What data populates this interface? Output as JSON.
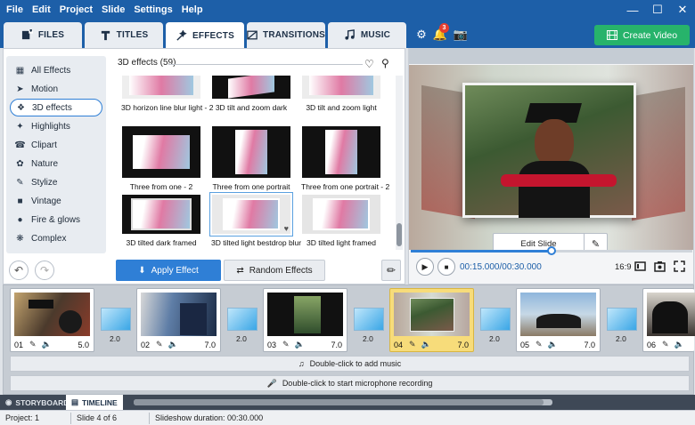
{
  "menu": [
    "File",
    "Edit",
    "Project",
    "Slide",
    "Settings",
    "Help"
  ],
  "tabs": [
    {
      "label": "FILES",
      "icon": "files-icon"
    },
    {
      "label": "TITLES",
      "icon": "titles-icon"
    },
    {
      "label": "EFFECTS",
      "icon": "effects-icon"
    },
    {
      "label": "TRANSITIONS",
      "icon": "transitions-icon"
    },
    {
      "label": "MUSIC",
      "icon": "music-icon"
    }
  ],
  "notification_count": "3",
  "create_video_label": "Create Video",
  "categories": [
    {
      "label": "All Effects",
      "icon": "grid-icon"
    },
    {
      "label": "Motion",
      "icon": "motion-icon"
    },
    {
      "label": "3D effects",
      "icon": "cube-icon"
    },
    {
      "label": "Highlights",
      "icon": "sparkle-icon"
    },
    {
      "label": "Clipart",
      "icon": "clipart-icon"
    },
    {
      "label": "Nature",
      "icon": "leaf-icon"
    },
    {
      "label": "Stylize",
      "icon": "stylize-icon"
    },
    {
      "label": "Vintage",
      "icon": "vintage-icon"
    },
    {
      "label": "Fire & glows",
      "icon": "fire-icon"
    },
    {
      "label": "Complex",
      "icon": "complex-icon"
    }
  ],
  "effects_header": "3D effects (59)",
  "effects": [
    "3D horizon line blur light - 2",
    "3D tilt and zoom dark",
    "3D tilt and zoom light",
    "Three from one - 2",
    "Three from one portrait",
    "Three from one portrait - 2",
    "3D tilted dark framed",
    "3D tilted light bestdrop blur",
    "3D tilted light framed"
  ],
  "apply_effect_label": "Apply Effect",
  "random_effects_label": "Random Effects",
  "edit_slide_label": "Edit Slide",
  "timecode": "00:15.000/00:30.000",
  "playback_progress": 0.5,
  "aspect_ratio": "16:9",
  "slides": [
    {
      "num": "01",
      "dur": "5.0"
    },
    {
      "num": "02",
      "dur": "7.0"
    },
    {
      "num": "03",
      "dur": "7.0"
    },
    {
      "num": "04",
      "dur": "7.0"
    },
    {
      "num": "05",
      "dur": "7.0"
    },
    {
      "num": "06",
      "dur": ""
    }
  ],
  "transitions": [
    "2.0",
    "2.0",
    "2.0",
    "2.0",
    "2.0"
  ],
  "music_bar_label": "Double-click to add music",
  "mic_bar_label": "Double-click to start microphone recording",
  "bottom_tabs": [
    "STORYBOARD",
    "TIMELINE"
  ],
  "status": {
    "project": "Project: 1",
    "slide": "Slide 4 of 6",
    "duration": "Slideshow duration: 00:30.000"
  },
  "colors": {
    "accent": "#1d5fa8",
    "create": "#27b36b",
    "apply": "#2f7fd6"
  }
}
